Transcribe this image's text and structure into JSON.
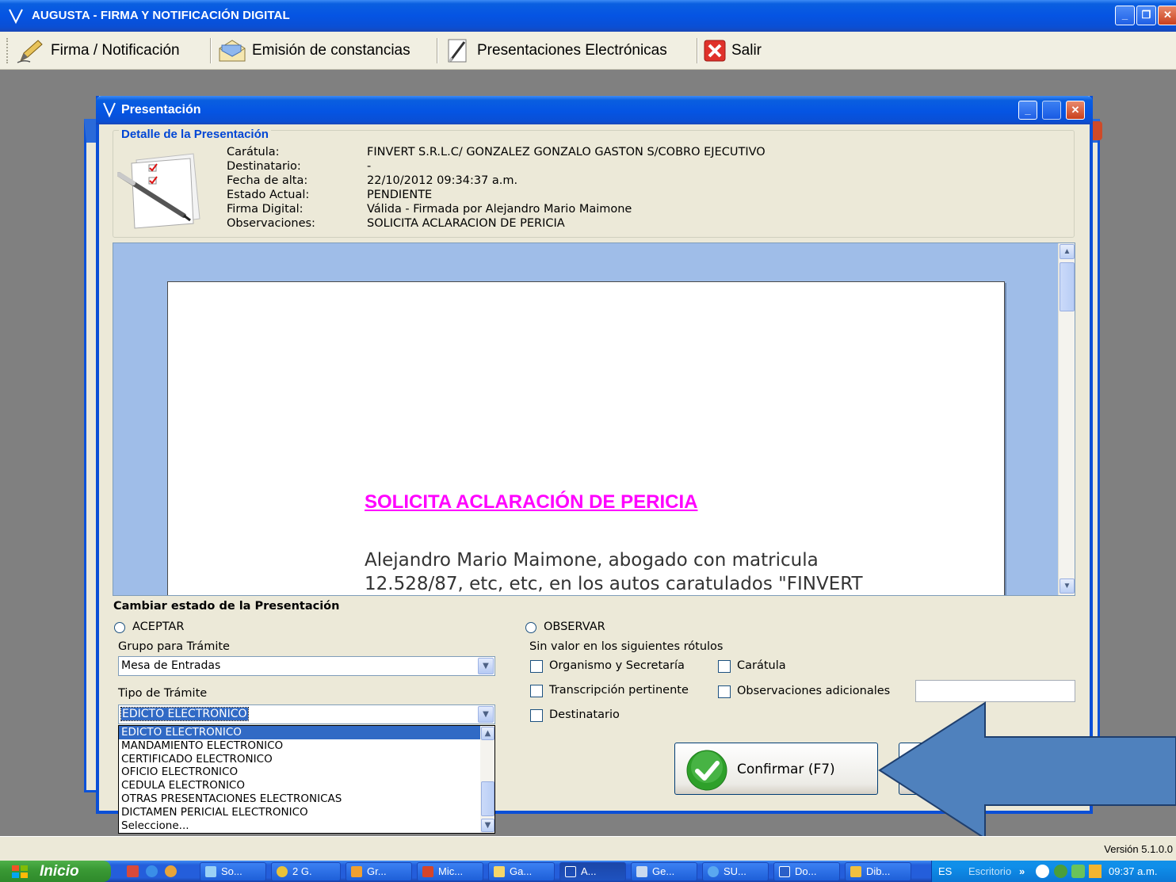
{
  "app": {
    "title": "AUGUSTA - FIRMA Y NOTIFICACIÓN DIGITAL",
    "window_buttons": {
      "minimize": "_",
      "restore": "❐",
      "close": "✕"
    }
  },
  "toolbar": {
    "items": [
      {
        "label": "Firma / Notificación",
        "icon": "pen-icon"
      },
      {
        "label": "Emisión de constancias",
        "icon": "envelope-icon"
      },
      {
        "label": "Presentaciones Electrónicas",
        "icon": "document-pen-icon"
      },
      {
        "label": "Salir",
        "icon": "close-red-icon"
      }
    ]
  },
  "dialog": {
    "title": "Presentación",
    "detail": {
      "legend": "Detalle de la Presentación",
      "labels": [
        "Carátula:",
        "Destinatario:",
        "Fecha de alta:",
        "Estado Actual:",
        "Firma Digital:",
        "Observaciones:"
      ],
      "values": [
        "FINVERT S.R.L.C/ GONZALEZ GONZALO GASTON S/COBRO EJECUTIVO",
        "-",
        "22/10/2012 09:34:37 a.m.",
        "PENDIENTE",
        "Válida - Firmada por Alejandro Mario Maimone",
        "SOLICITA ACLARACION DE PERICIA"
      ]
    },
    "preview": {
      "heading": "SOLICITA ACLARACIÓN DE PERICIA",
      "paragraph_line1": "Alejandro Mario Maimone, abogado con matricula",
      "paragraph_line2": "12.528/87, etc, etc, en los autos caratulados \"FINVERT"
    },
    "state_section": {
      "title": "Cambiar estado de la Presentación",
      "accept_label": "ACEPTAR",
      "observe_label": "OBSERVAR",
      "group_label": "Grupo para Trámite",
      "group_value": "Mesa de Entradas",
      "type_label": "Tipo de Trámite",
      "type_value": "EDICTO ELECTRONICO",
      "type_options": [
        "EDICTO ELECTRONICO",
        "MANDAMIENTO ELECTRONICO",
        "CERTIFICADO ELECTRONICO",
        "OFICIO ELECTRONICO",
        "CEDULA ELECTRONICO",
        "OTRAS PRESENTACIONES ELECTRONICAS",
        "DICTAMEN PERICIAL ELECTRONICO",
        "Seleccione..."
      ],
      "no_value_label": "Sin valor en los siguientes rótulos",
      "checkboxes": {
        "organismo": "Organismo y Secretaría",
        "caratula": "Carátula",
        "transcripcion": "Transcripción pertinente",
        "observaciones": "Observaciones adicionales",
        "destinatario": "Destinatario"
      },
      "observaciones_text": ""
    },
    "confirm_label": "Confirmar (F7)"
  },
  "status": {
    "version": "Versión 5.1.0.0"
  },
  "taskbar": {
    "start_label": "Inicio",
    "buttons": [
      "So...",
      "2 G.",
      "Gr...",
      "Mic...",
      "Ga...",
      "A...",
      "Ge...",
      "SU...",
      "Do...",
      "Dib..."
    ],
    "language": "ES",
    "desktop": "Escritorio",
    "clock": "09:37 a.m."
  },
  "colors": {
    "titlebar_blue": "#0554e3",
    "heading_magenta": "#ff00ff",
    "selection_blue": "#316ac5",
    "legend_blue": "#0046d5",
    "confirm_green": "#2ea02a",
    "arrow_blue": "#4f81bd"
  }
}
